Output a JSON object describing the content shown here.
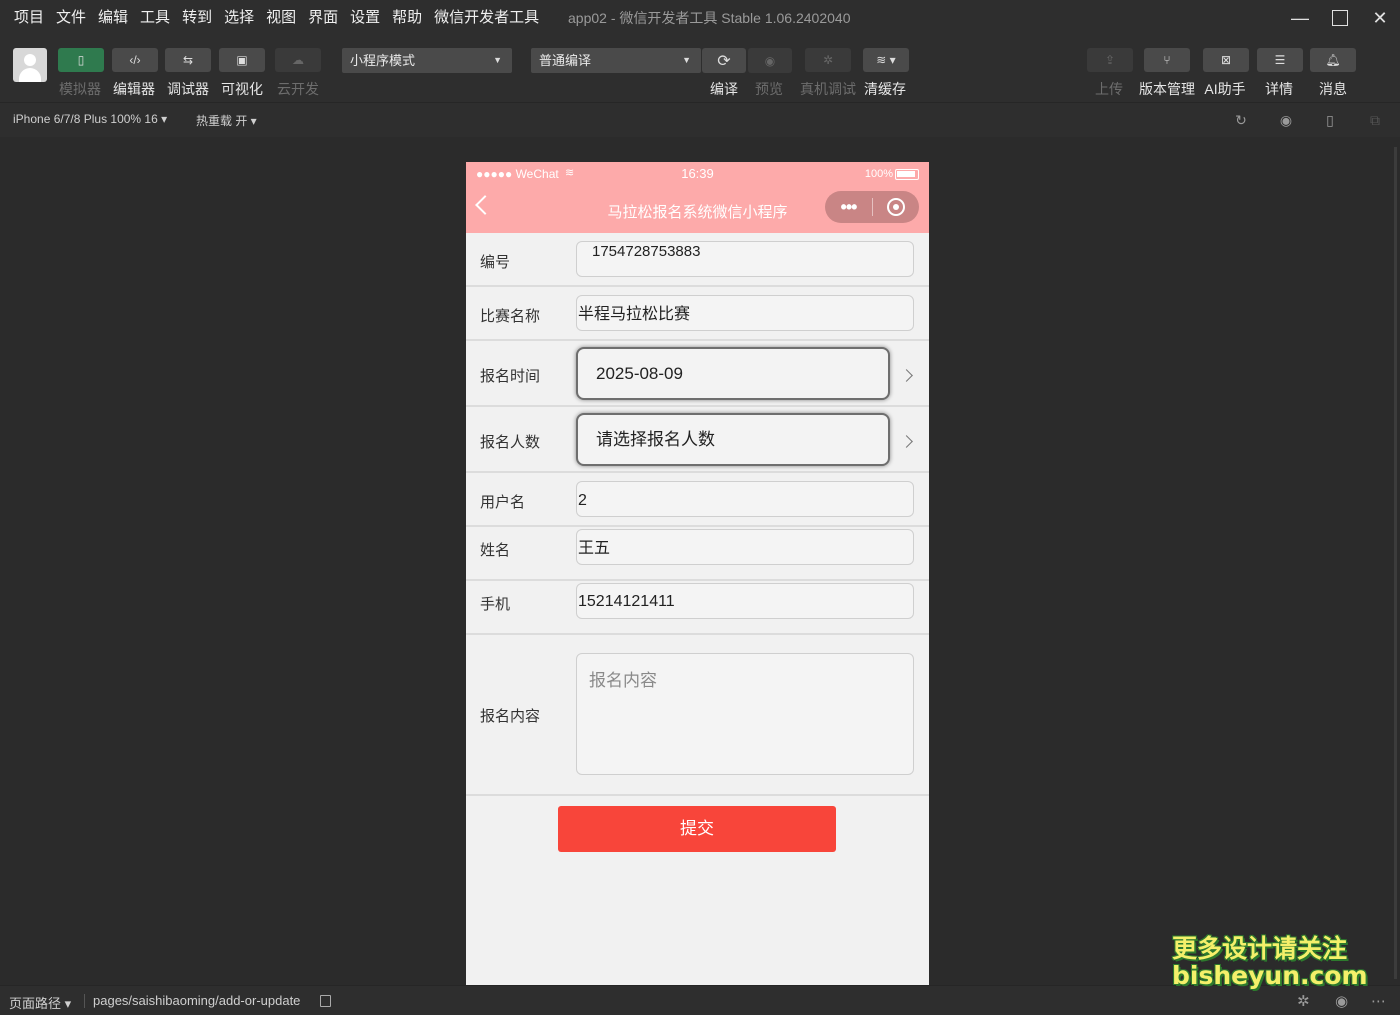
{
  "menu": [
    "项目",
    "文件",
    "编辑",
    "工具",
    "转到",
    "选择",
    "视图",
    "界面",
    "设置",
    "帮助",
    "微信开发者工具"
  ],
  "window_title": "app02 - 微信开发者工具 Stable 1.06.2402040",
  "toolbar": {
    "simulator": "模拟器",
    "editor": "编辑器",
    "debugger": "调试器",
    "visual": "可视化",
    "cloud": "云开发",
    "mode_select": "小程序模式",
    "compile_select": "普通编译",
    "compile": "编译",
    "preview": "预览",
    "remote_debug": "真机调试",
    "clear_cache": "清缓存",
    "upload": "上传",
    "version": "版本管理",
    "ai": "AI助手",
    "details": "详情",
    "messages": "消息"
  },
  "devicebar": {
    "device": "iPhone 6/7/8 Plus 100% 16 ▾",
    "hot_reload": "热重载 开 ▾"
  },
  "phone": {
    "status": {
      "signal": "●●●●● WeChat",
      "time": "16:39",
      "battery": "100%"
    },
    "nav_title": "马拉松报名系统微信小程序",
    "capsule_dots": "•••",
    "fields": [
      {
        "label": "编号",
        "value": "1754728753883"
      },
      {
        "label": "比赛名称",
        "value": "半程马拉松比赛"
      },
      {
        "label": "报名时间",
        "value": "2025-08-09"
      },
      {
        "label": "报名人数",
        "value": "请选择报名人数"
      },
      {
        "label": "用户名",
        "value": "2"
      },
      {
        "label": "姓名",
        "value": "王五"
      },
      {
        "label": "手机",
        "value": "15214121411"
      },
      {
        "label": "报名内容",
        "placeholder": "报名内容"
      }
    ],
    "submit": "提交"
  },
  "bottombar": {
    "path_label": "页面路径 ▾",
    "path": "pages/saishibaoming/add-or-update"
  },
  "watermark": {
    "line1": "更多设计请关注",
    "line2": "bisheyun.com"
  }
}
